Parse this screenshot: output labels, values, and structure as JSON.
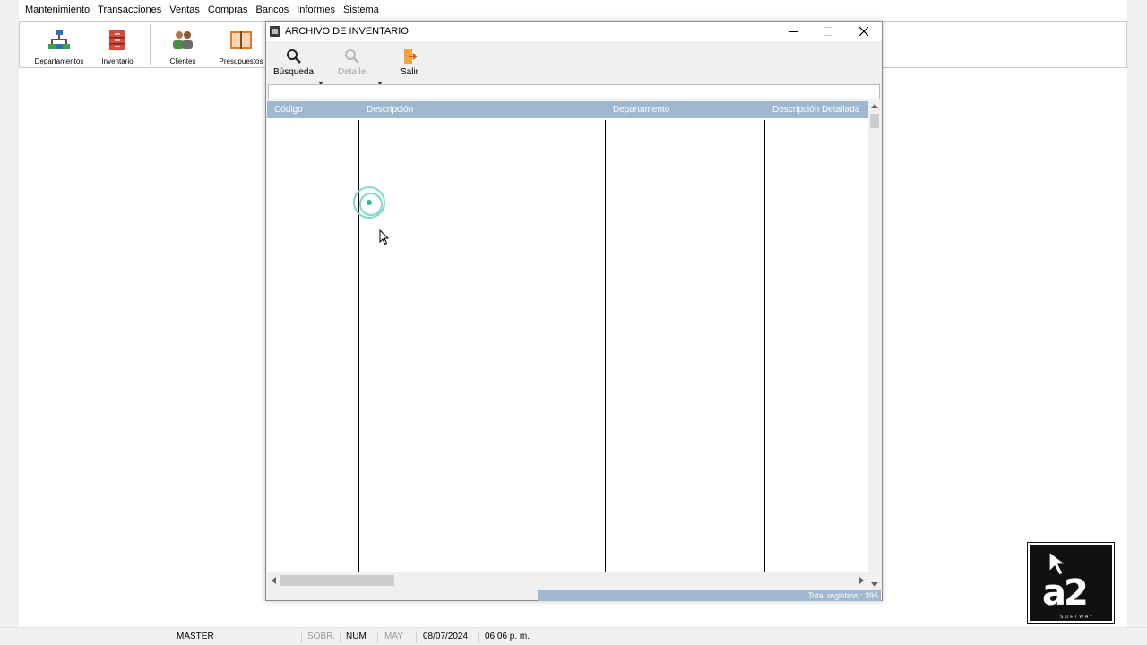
{
  "menubar": {
    "items": [
      "Mantenimiento",
      "Transacciones",
      "Ventas",
      "Compras",
      "Bancos",
      "Informes",
      "Sistema"
    ]
  },
  "toolbar": {
    "buttons": [
      {
        "label": "Departamentos",
        "icon": "org-chart-icon"
      },
      {
        "label": "Inventario",
        "icon": "inventory-box-icon"
      },
      {
        "label": "Clientes",
        "icon": "clients-icon"
      },
      {
        "label": "Presupuestos",
        "icon": "budget-book-icon"
      }
    ]
  },
  "dialog": {
    "title": "ARCHIVO DE INVENTARIO",
    "toolbar": {
      "search_label": "Búsqueda",
      "detail_label": "Detalle",
      "exit_label": "Salir"
    },
    "search_value": "",
    "grid": {
      "columns": [
        "Código",
        "Descripción",
        "Departamento",
        "Descripción Detallada"
      ],
      "rows": []
    },
    "status_text": "Total registros : 396"
  },
  "statusbar": {
    "user": "MASTER",
    "sobr": "SOBR.",
    "num": "NUM",
    "may": "MAY",
    "date": "08/07/2024",
    "time": "06:06 p. m."
  },
  "logo": {
    "mark": "a2",
    "subtitle": "SOFTWAY"
  },
  "colors": {
    "grid_header": "#a0b8cf",
    "click_indicator": "#7fd8cc"
  }
}
